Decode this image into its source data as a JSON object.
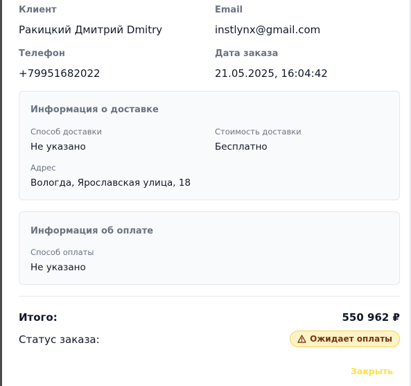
{
  "order": {
    "client_label": "Клиент",
    "client_value": "Ракицкий Дмитрий Dmitry",
    "email_label": "Email",
    "email_value": "instlynx@gmail.com",
    "phone_label": "Телефон",
    "phone_value": "+79951682022",
    "date_label": "Дата заказа",
    "date_value": "21.05.2025, 16:04:42"
  },
  "delivery": {
    "title": "Информация о доставке",
    "method_label": "Способ доставки",
    "method_value": "Не указано",
    "cost_label": "Стоимость доставки",
    "cost_value": "Бесплатно",
    "address_label": "Адрес",
    "address_value": "Вологда, Ярославская улица, 18"
  },
  "payment": {
    "title": "Информация об оплате",
    "method_label": "Способ оплаты",
    "method_value": "Не указано"
  },
  "summary": {
    "total_label": "Итого:",
    "total_value": "550 962 ₽",
    "status_label": "Статус заказа:",
    "status_value": "Ожидает оплаты",
    "status_icon": "warning-triangle-icon"
  },
  "actions": {
    "close_label": "Закрыть"
  },
  "colors": {
    "badge_bg": "#fef3c7",
    "badge_text": "#78350f",
    "close_text": "#fde047",
    "card_bg": "#f9fafb"
  }
}
